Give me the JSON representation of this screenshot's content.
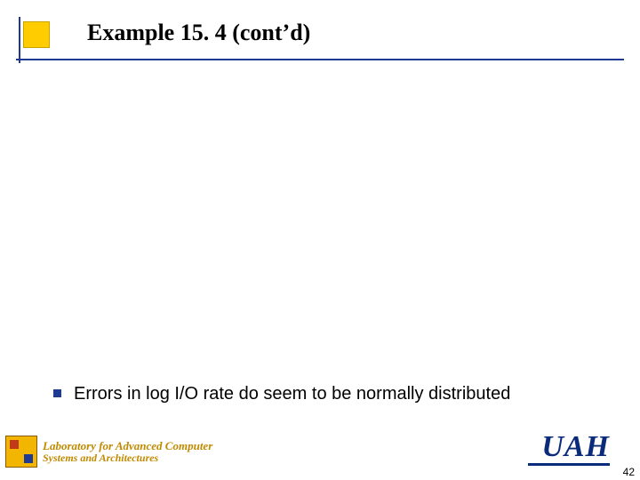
{
  "title": "Example 15. 4 (cont’d)",
  "bullet": "Errors in log I/O rate do seem to be normally distributed",
  "footer": {
    "lab_line1": "Laboratory for Advanced Computer",
    "lab_line2": "Systems and Architectures",
    "uah": "UAH",
    "page": "42"
  }
}
